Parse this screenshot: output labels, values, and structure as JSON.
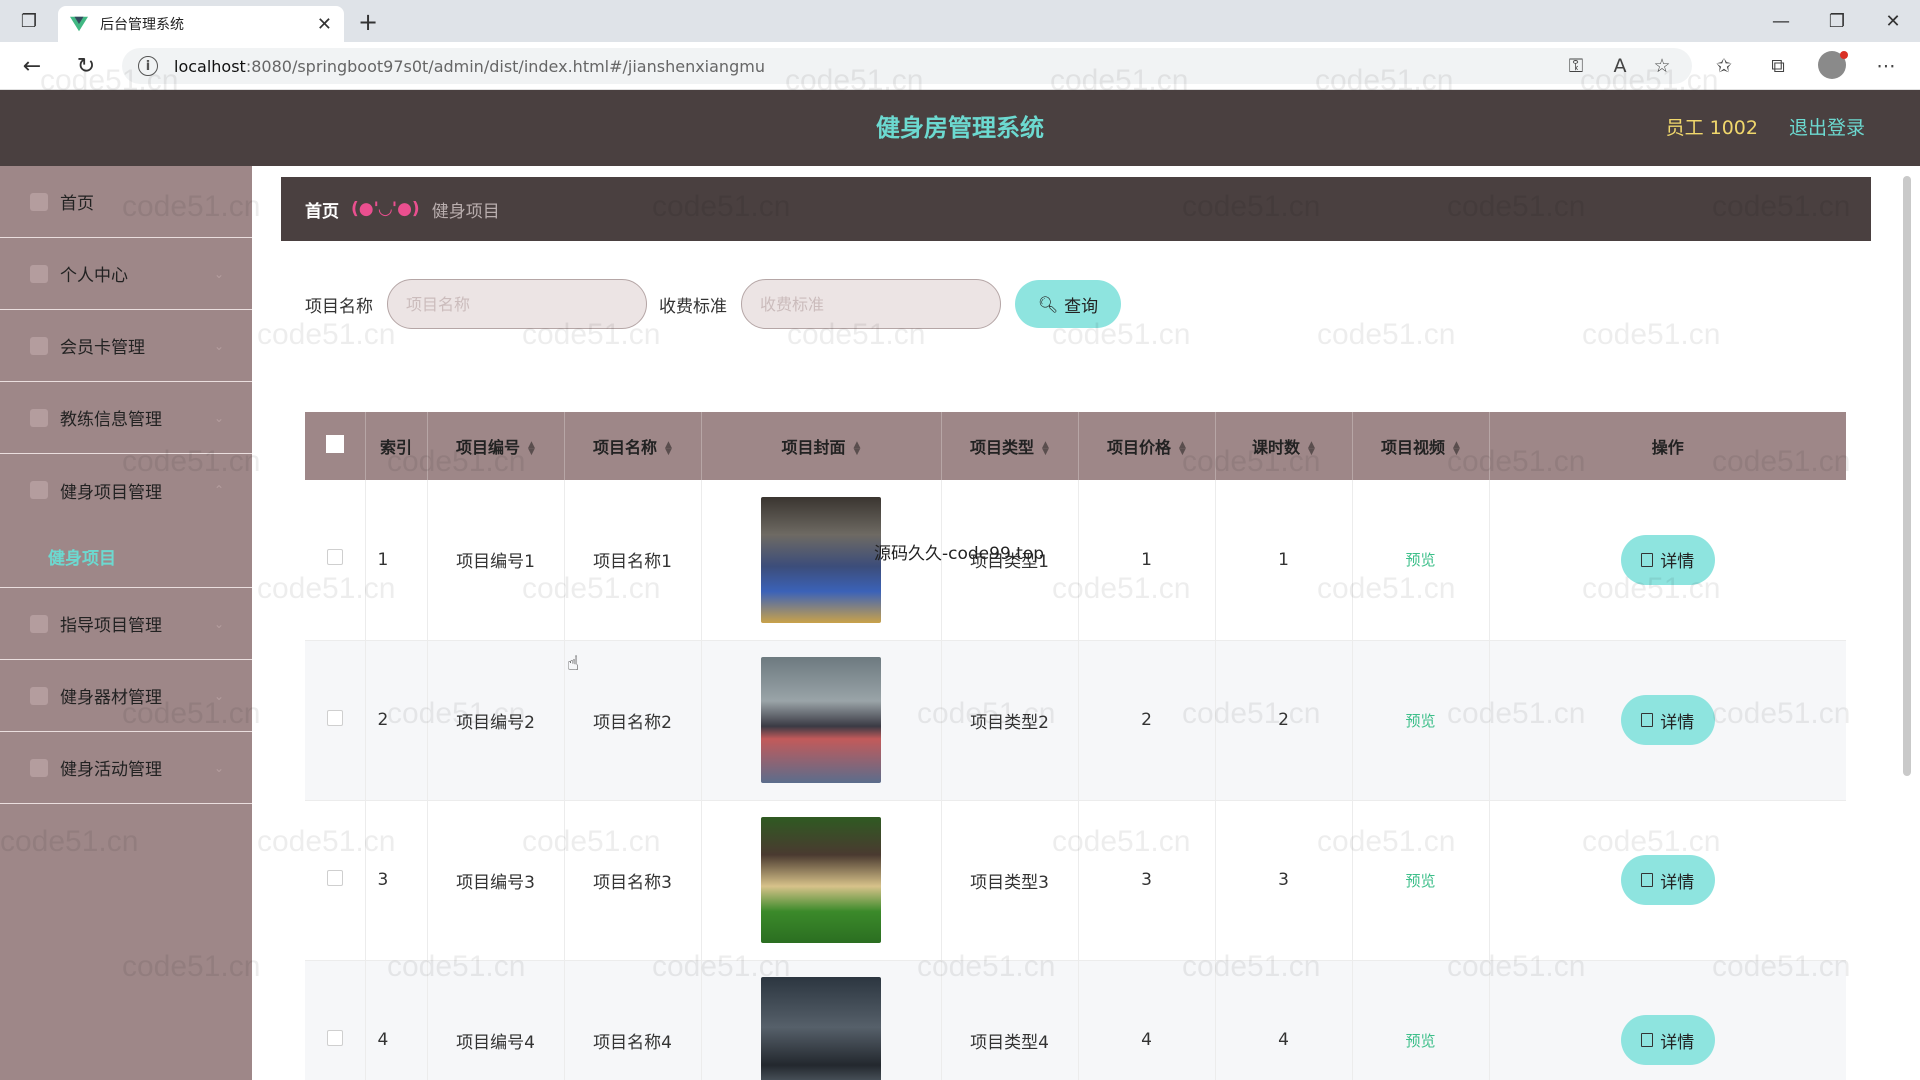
{
  "browser": {
    "tab_title": "后台管理系统",
    "url_host": "localhost",
    "url_path": ":8080/springboot97s0t/admin/dist/index.html#/jianshenxiangmu"
  },
  "header": {
    "title": "健身房管理系统",
    "user": "员工 1002",
    "logout": "退出登录"
  },
  "sidebar": {
    "items": [
      {
        "label": "首页"
      },
      {
        "label": "个人中心"
      },
      {
        "label": "会员卡管理"
      },
      {
        "label": "教练信息管理"
      },
      {
        "label": "健身项目管理"
      },
      {
        "label": "指导项目管理"
      },
      {
        "label": "健身器材管理"
      },
      {
        "label": "健身活动管理"
      }
    ],
    "submenu_active": "健身项目"
  },
  "breadcrumb": {
    "home": "首页",
    "separator": "(●'◡'●)",
    "current": "健身项目"
  },
  "search": {
    "name_label": "项目名称",
    "name_placeholder": "项目名称",
    "price_label": "收费标准",
    "price_placeholder": "收费标准",
    "button": "查询"
  },
  "table": {
    "headers": [
      "索引",
      "项目编号",
      "项目名称",
      "项目封面",
      "项目类型",
      "项目价格",
      "课时数",
      "项目视频",
      "操作"
    ],
    "rows": [
      {
        "index": "1",
        "code": "项目编号1",
        "name": "项目名称1",
        "type": "项目类型1",
        "price": "1",
        "hours": "1",
        "video": "预览",
        "action": "详情"
      },
      {
        "index": "2",
        "code": "项目编号2",
        "name": "项目名称2",
        "type": "项目类型2",
        "price": "2",
        "hours": "2",
        "video": "预览",
        "action": "详情"
      },
      {
        "index": "3",
        "code": "项目编号3",
        "name": "项目名称3",
        "type": "项目类型3",
        "price": "3",
        "hours": "3",
        "video": "预览",
        "action": "详情"
      },
      {
        "index": "4",
        "code": "项目编号4",
        "name": "项目名称4",
        "type": "项目类型4",
        "price": "4",
        "hours": "4",
        "video": "预览",
        "action": "详情"
      }
    ]
  },
  "overlay_text": "源码久久-code99.top",
  "watermark": "code51.cn",
  "colors": {
    "header_bg": "#4a4040",
    "sidebar_bg": "#9e8788",
    "accent": "#6cd9d0",
    "button": "#8ee4df",
    "user_text": "#f0d76c",
    "breadcrumb_sep": "#ea4f8f",
    "preview": "#3dbf8a"
  }
}
